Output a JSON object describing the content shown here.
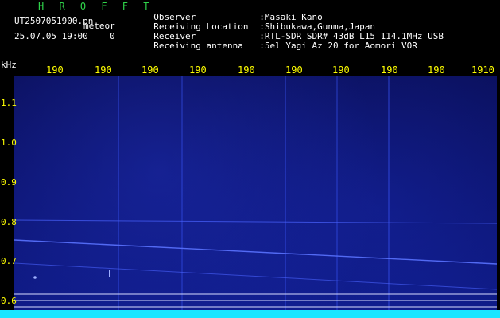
{
  "header": {
    "app_title": "H R O F F T",
    "file_name": "UT2507051900.pn",
    "meteor_label": "meteor",
    "datetime": "25.07.05 19:00",
    "count": "0_",
    "info": [
      {
        "key": "Observer",
        "value": ":Masaki Kano"
      },
      {
        "key": "Receiving Location",
        "value": ":Shibukawa,Gunma,Japan"
      },
      {
        "key": "Receiver",
        "value": ":RTL-SDR SDR# 43dB L15 114.1MHz USB"
      },
      {
        "key": "Receiving antenna",
        "value": ":5el Yagi Az 20 for Aomori VOR"
      }
    ]
  },
  "axes": {
    "unit_label": "kHz",
    "time_ticks": [
      "190",
      "190",
      "190",
      "190",
      "190",
      "190",
      "190",
      "190",
      "190",
      "1910"
    ],
    "freq_ticks": [
      "1.1",
      "1.0",
      "0.9",
      "0.8",
      "0.7",
      "0.6"
    ]
  },
  "colors": {
    "background": "#000000",
    "title_green": "#2fd34a",
    "tick_yellow": "#ffff00",
    "waterfall_blue": "#0c1470",
    "spectrum_cyan": "#19e6ff"
  }
}
